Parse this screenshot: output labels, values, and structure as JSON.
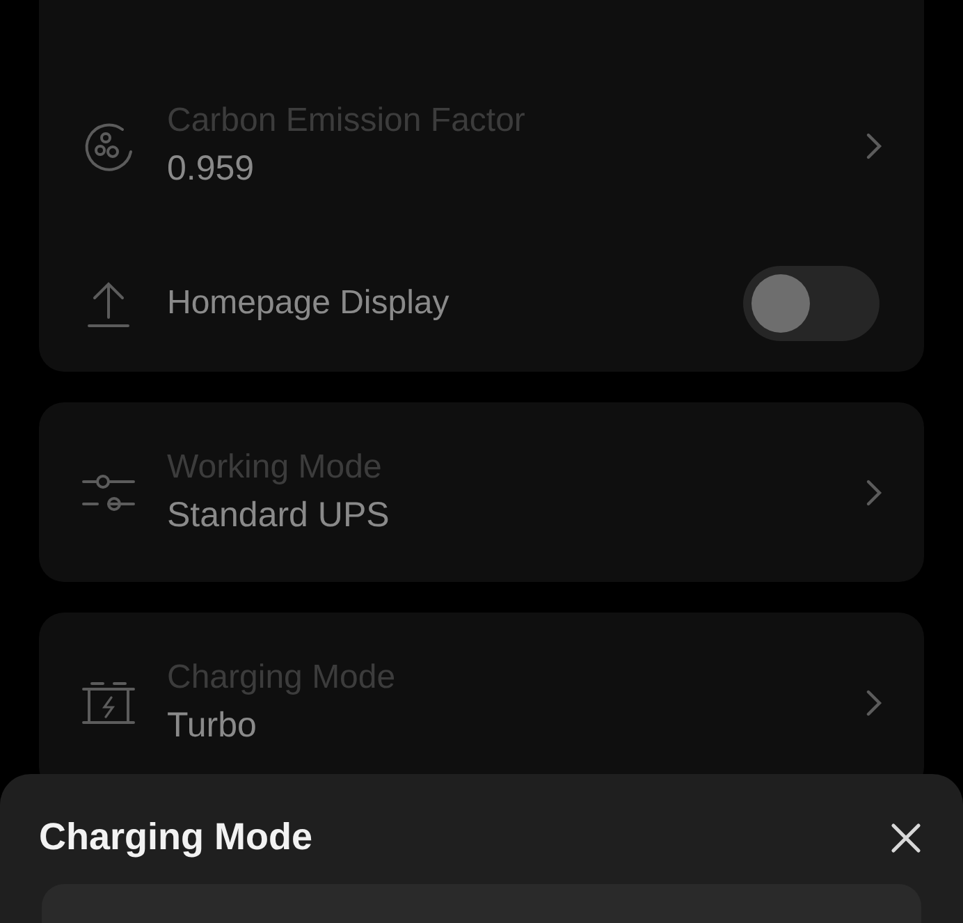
{
  "settings_cards": [
    {
      "rows": [
        {
          "kind": "value",
          "label": "Carbon Emission Factor",
          "value": "0.959"
        },
        {
          "kind": "toggle",
          "label": "Homepage Display",
          "on": false
        }
      ]
    },
    {
      "rows": [
        {
          "kind": "value",
          "label": "Working Mode",
          "value": "Standard UPS"
        }
      ]
    },
    {
      "rows": [
        {
          "kind": "value",
          "label": "Charging Mode",
          "value": "Turbo"
        }
      ]
    }
  ],
  "sheet": {
    "title": "Charging Mode"
  }
}
